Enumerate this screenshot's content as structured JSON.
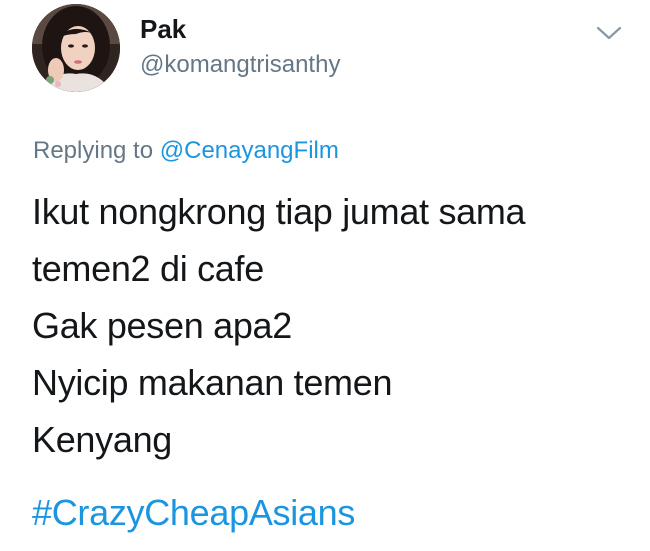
{
  "tweet": {
    "author": {
      "display_name": "Pak",
      "handle": "@komangtrisanthy",
      "avatar_icon": "profile-photo"
    },
    "menu_icon": "chevron-down-icon",
    "reply": {
      "prefix": "Replying to",
      "mention": "@CenayangFilm"
    },
    "lines": [
      "Ikut nongkrong tiap jumat sama",
      "temen2 di cafe",
      "Gak pesen apa2",
      "Nyicip makanan temen",
      "Kenyang"
    ],
    "hashtag": "#CrazyCheapAsians"
  },
  "colors": {
    "text": "#14171a",
    "secondary": "#657786",
    "link": "#1b95e0",
    "background": "#ffffff"
  }
}
